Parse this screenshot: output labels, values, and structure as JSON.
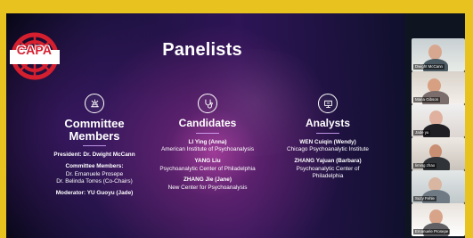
{
  "slide": {
    "logo_text": "CAPA",
    "title": "Panelists",
    "columns": {
      "committee": {
        "heading_lines": [
          "Committee",
          "Members"
        ],
        "icon": "committee-icon",
        "lines": [
          {
            "text": "President: Dr. Dwight McCann",
            "style": "bold"
          },
          {
            "text": "Committee Members:",
            "style": "bold"
          },
          {
            "text": "Dr. Emanuele Prosepe",
            "style": "normal"
          },
          {
            "text": "Dr. Belinda Torres (Co-Chairs)",
            "style": "normal"
          },
          {
            "text": "Moderator: YU Guoyu (Jade)",
            "style": "bold"
          }
        ]
      },
      "candidates": {
        "heading": "Candidates",
        "icon": "stethoscope-icon",
        "lines": [
          {
            "text": "LI Ying (Anna)",
            "style": "bold"
          },
          {
            "text": "American Institute of Psychoanalysis",
            "style": "normal"
          },
          {
            "text": "YANG Liu",
            "style": "bold"
          },
          {
            "text": "Psychoanalytic Center of Philadelphia",
            "style": "normal"
          },
          {
            "text": "ZHANG Jie (Jane)",
            "style": "bold"
          },
          {
            "text": "New Center for Psychoanalysis",
            "style": "normal"
          }
        ]
      },
      "analysts": {
        "heading": "Analysts",
        "icon": "presentation-icon",
        "lines": [
          {
            "text": "WEN Cuiqin (Wendy)",
            "style": "bold"
          },
          {
            "text": "Chicago Psychoanalytic Institute",
            "style": "normal"
          },
          {
            "text": "ZHANG Yajuan (Barbara)",
            "style": "bold"
          },
          {
            "text": "Psychoanalytic Center of",
            "style": "normal"
          },
          {
            "text": "Philadelphia",
            "style": "normal"
          }
        ]
      }
    }
  },
  "participants": [
    {
      "name": "Dwight McCann"
    },
    {
      "name": "Maria Gibson"
    },
    {
      "name": "Jade yu"
    },
    {
      "name": "liming zhao"
    },
    {
      "name": "Suzy Fehle"
    },
    {
      "name": "Emanuele Prosepe"
    }
  ],
  "colors": {
    "outer_frame": "#e8c21f",
    "slide_background": "#18113a",
    "slide_glow": "#cc4bb4",
    "logo_red": "#d51f2f"
  }
}
